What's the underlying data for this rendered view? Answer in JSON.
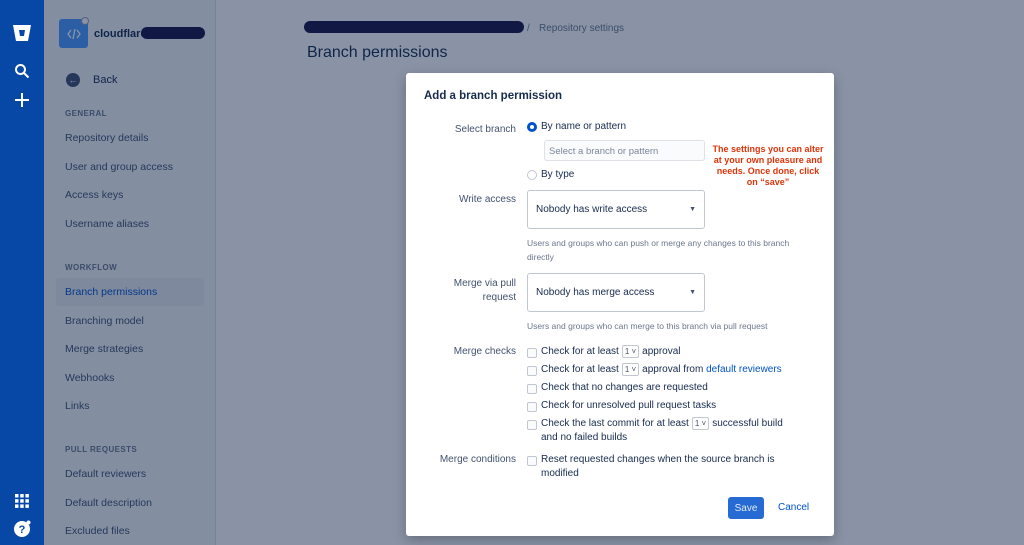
{
  "globalnav": {
    "icons": [
      "bitbucket-logo-icon",
      "search-icon",
      "plus-icon",
      "app-switcher-icon",
      "help-icon"
    ]
  },
  "sidebar": {
    "repo_name": "cloudflare_",
    "back_label": "Back",
    "sections": [
      {
        "title": "GENERAL",
        "items": [
          "Repository details",
          "User and group access",
          "Access keys",
          "Username aliases"
        ]
      },
      {
        "title": "WORKFLOW",
        "items": [
          "Branch permissions",
          "Branching model",
          "Merge strategies",
          "Webhooks",
          "Links"
        ]
      },
      {
        "title": "PULL REQUESTS",
        "items": [
          "Default reviewers",
          "Default description",
          "Excluded files"
        ]
      }
    ],
    "active_item": "Branch permissions"
  },
  "main": {
    "breadcrumb_separator": "/",
    "breadcrumb_current": "Repository settings",
    "page_title": "Branch permissions"
  },
  "dialog": {
    "title": "Add a branch permission",
    "select_branch_label": "Select branch",
    "by_name_option": "By name or pattern",
    "branch_input_placeholder": "Select a branch or pattern",
    "by_type_option": "By type",
    "annotation": "The settings you can alter at your own pleasure and needs. Once done, click on “save”",
    "write_access_label": "Write access",
    "write_access_value": "Nobody has write access",
    "write_access_help": "Users and groups who can push or merge any changes to this branch directly",
    "merge_pr_label": "Merge via pull request",
    "merge_pr_value": "Nobody has merge access",
    "merge_pr_help": "Users and groups who can merge to this branch via pull request",
    "merge_checks_label": "Merge checks",
    "checks": {
      "c1_pre": "Check for at least",
      "c1_count": "1",
      "c1_post": "approval",
      "c2_pre": "Check for at least",
      "c2_count": "1",
      "c2_mid": "approval from",
      "c2_link": "default reviewers",
      "c3": "Check that no changes are requested",
      "c4": "Check for unresolved pull request tasks",
      "c5_pre": "Check the last commit for at least",
      "c5_count": "1",
      "c5_post": "successful build",
      "c5_line2": "and no failed builds"
    },
    "merge_conditions_label": "Merge conditions",
    "merge_condition_text": "Reset requested changes when the source branch is modified",
    "save_label": "Save",
    "cancel_label": "Cancel"
  },
  "colors": {
    "global_nav": "#0747a6",
    "primary": "#0052cc",
    "annotation": "#de350b",
    "overlay": "#091e42"
  }
}
